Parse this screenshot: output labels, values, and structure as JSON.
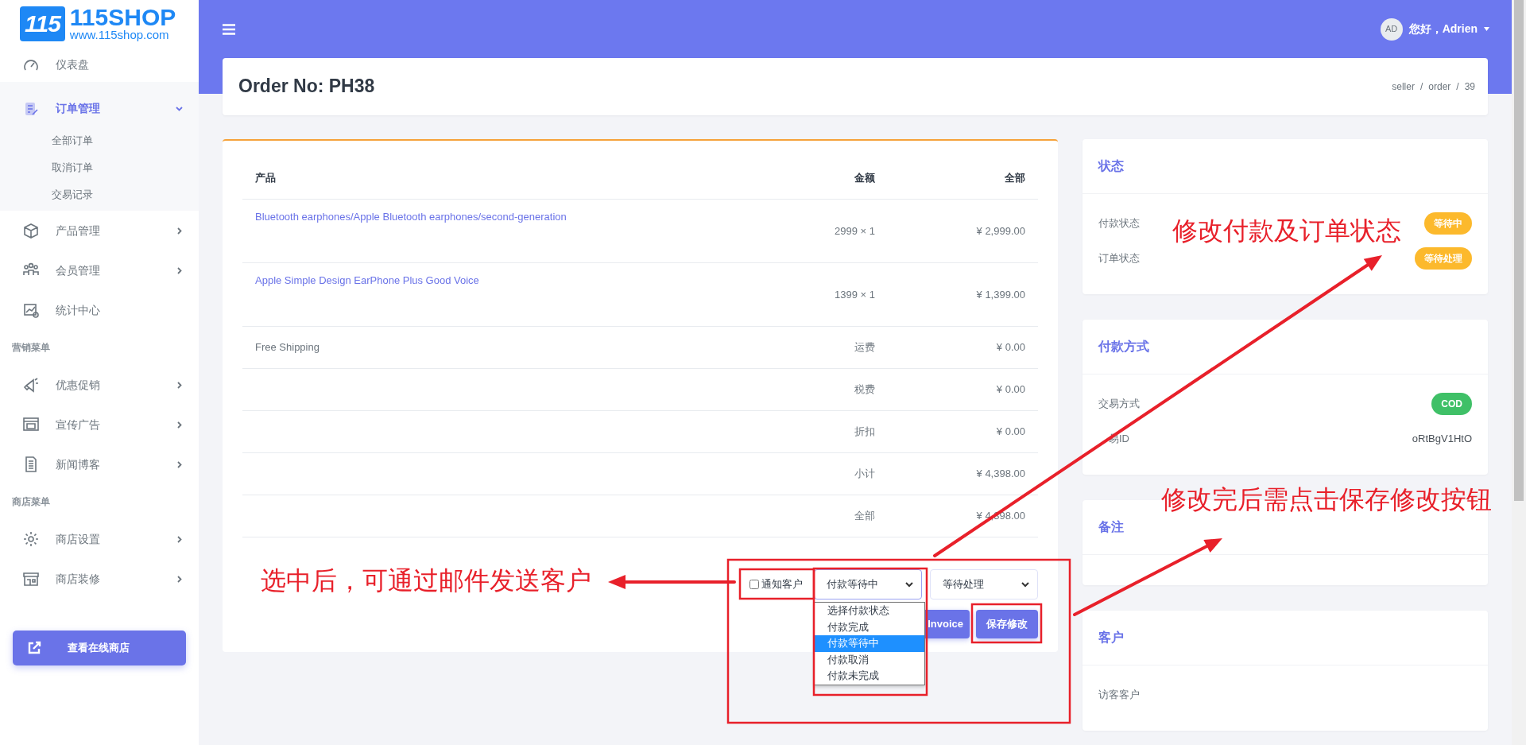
{
  "logo": {
    "mark": "115",
    "name": "115SHOP",
    "url": "www.115shop.com"
  },
  "sidebar": {
    "items": [
      {
        "kind": "link",
        "label": "仪表盘",
        "selected": false
      },
      {
        "kind": "menu",
        "label": "订单管理",
        "selected": true,
        "expanded": true,
        "children": [
          {
            "label": "全部订单"
          },
          {
            "label": "取消订单"
          },
          {
            "label": "交易记录"
          }
        ]
      },
      {
        "kind": "menu",
        "label": "产品管理",
        "selected": false,
        "expanded": false
      },
      {
        "kind": "menu",
        "label": "会员管理",
        "selected": false,
        "expanded": false
      },
      {
        "kind": "link",
        "label": "统计中心",
        "selected": false
      },
      {
        "kind": "heading",
        "label": "营销菜单"
      },
      {
        "kind": "menu",
        "label": "优惠促销",
        "selected": false,
        "expanded": false
      },
      {
        "kind": "menu",
        "label": "宣传广告",
        "selected": false,
        "expanded": false
      },
      {
        "kind": "menu",
        "label": "新闻博客",
        "selected": false,
        "expanded": false
      },
      {
        "kind": "heading",
        "label": "商店菜单"
      },
      {
        "kind": "menu",
        "label": "商店设置",
        "selected": false,
        "expanded": false
      },
      {
        "kind": "menu",
        "label": "商店装修",
        "selected": false,
        "expanded": false
      }
    ],
    "store_button": "查看在线商店"
  },
  "header": {
    "initials": "AD",
    "greeting": "您好，Adrien"
  },
  "page_title": "Order No: PH38",
  "breadcrumb": [
    "seller",
    "/",
    "order",
    "/",
    "39"
  ],
  "order_table": {
    "columns": [
      "产品",
      "金额",
      "全部"
    ],
    "rows": [
      {
        "kind": "product",
        "product": "Bluetooth earphones/Apple Bluetooth earphones/second-generation",
        "amount": "2999 × 1",
        "total": "¥ 2,999.00"
      },
      {
        "kind": "product",
        "product": "Apple Simple Design EarPhone Plus Good Voice",
        "amount": "1399 × 1",
        "total": "¥ 1,399.00"
      },
      {
        "kind": "summary",
        "note": "Free Shipping",
        "label": "运费",
        "total": "¥ 0.00"
      },
      {
        "kind": "summary",
        "label": "税费",
        "total": "¥ 0.00"
      },
      {
        "kind": "summary",
        "label": "折扣",
        "total": "¥ 0.00"
      },
      {
        "kind": "summary",
        "label": "小计",
        "total": "¥ 4,398.00"
      },
      {
        "kind": "summary",
        "label": "全部",
        "total": "¥ 4,398.00"
      }
    ]
  },
  "actions": {
    "notify": {
      "label": "通知客户",
      "checked": false
    },
    "payment_select": {
      "value": "付款等待中",
      "expanded": true,
      "options": [
        {
          "label": "选择付款状态",
          "selected": false
        },
        {
          "label": "付款完成",
          "selected": false
        },
        {
          "label": "付款等待中",
          "selected": true
        },
        {
          "label": "付款取消",
          "selected": false
        },
        {
          "label": "付款未完成",
          "selected": false
        }
      ]
    },
    "order_select": {
      "value": "等待处理"
    },
    "invoice_button": "Invoice",
    "save_button": "保存修改"
  },
  "side_cards": [
    {
      "title": "状态",
      "rows": [
        {
          "label": "付款状态",
          "badge": "等待中",
          "color": "#fcb92c"
        },
        {
          "label": "订单状态",
          "badge": "等待处理",
          "color": "#fcb92c"
        }
      ]
    },
    {
      "title": "付款方式",
      "rows": [
        {
          "label": "交易方式",
          "badge": "COD",
          "color": "#3fc067"
        },
        {
          "label": "易ID",
          "value": "oRtBgV1HtO"
        }
      ]
    },
    {
      "title": "备注"
    },
    {
      "title": "客户",
      "rows": [
        {
          "label": "访客客户"
        }
      ]
    }
  ],
  "annotations": [
    "修改付款及订单状态",
    "修改完后需点击保存修改按钮",
    "选中后，可通过邮件发送客户"
  ]
}
